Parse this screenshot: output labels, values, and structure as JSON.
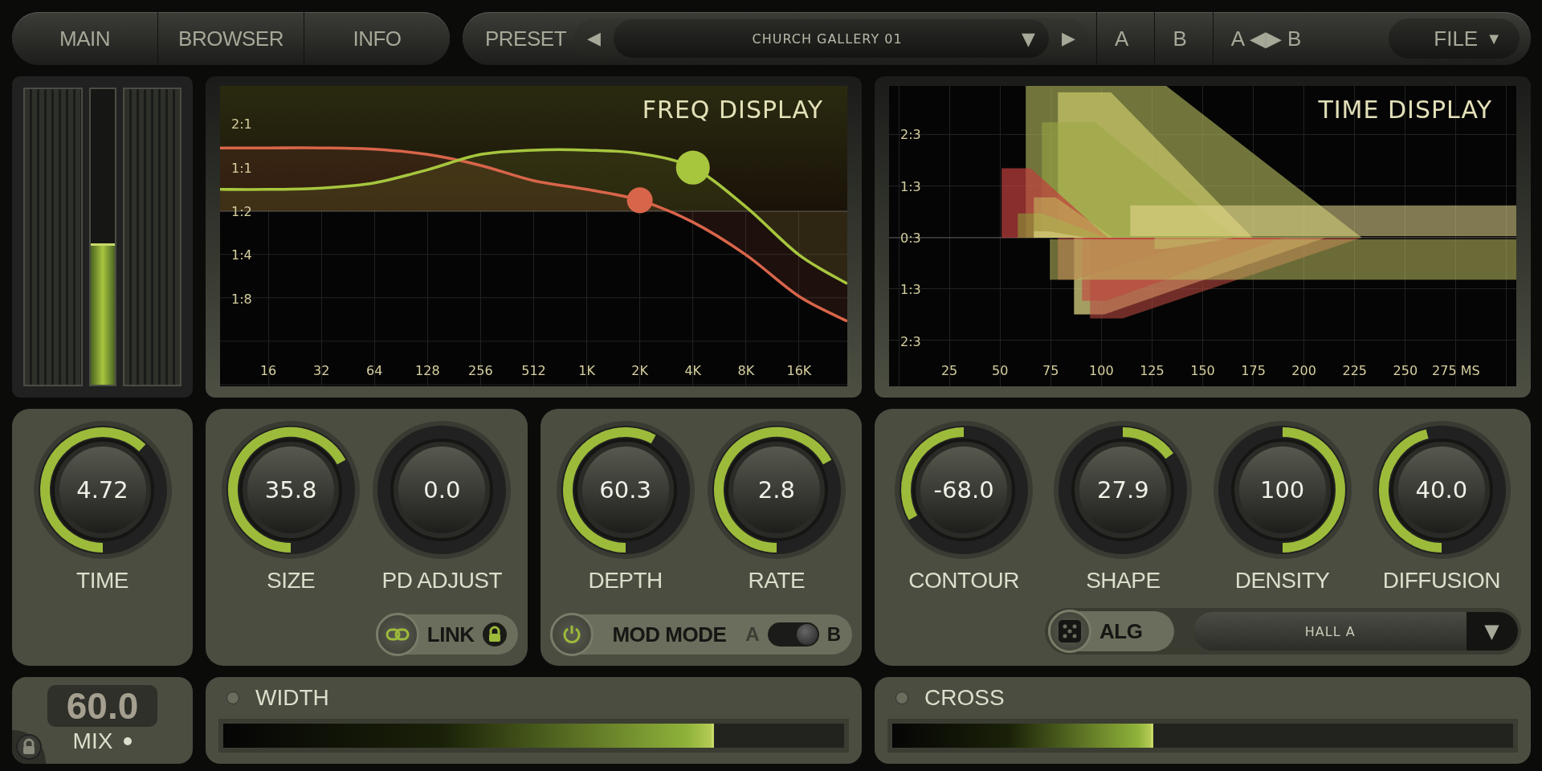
{
  "top_bar": {
    "tabs": [
      {
        "label": "MAIN",
        "selected": false
      },
      {
        "label": "BROWSER",
        "selected": false
      },
      {
        "label": "INFO",
        "selected": false
      }
    ],
    "preset": {
      "label": "PRESET",
      "prev": "◀",
      "name": "CHURCH GALLERY 01",
      "dropdown": "▼",
      "next": "▶"
    },
    "compare": [
      "A",
      "B",
      "A ◀▶ B"
    ],
    "file": {
      "label": "FILE",
      "caret": "▼"
    }
  },
  "meter": {
    "level": 0.47
  },
  "freq_display": {
    "title": "FREQ DISPLAY",
    "y_labels": [
      "2:1",
      "1:1",
      "1:2",
      "1:4",
      "1:8"
    ],
    "x_labels": [
      "16",
      "32",
      "64",
      "128",
      "256",
      "512",
      "1K",
      "2K",
      "4K",
      "8K",
      "16K"
    ]
  },
  "time_display": {
    "title": "TIME DISPLAY",
    "y_labels": [
      "2:3",
      "1:3",
      "0:3",
      "1:3",
      "2:3"
    ],
    "x_labels": [
      "25",
      "50",
      "75",
      "100",
      "125",
      "150",
      "175",
      "200",
      "225",
      "250",
      "275 MS"
    ]
  },
  "knob_groups": [
    {
      "knobs": [
        {
          "label": "TIME",
          "value": "4.72",
          "kind": "unipolar"
        }
      ]
    },
    {
      "knobs": [
        {
          "label": "SIZE",
          "value": "35.8",
          "kind": "unipolar"
        },
        {
          "label": "PD ADJUST",
          "value": "0.0",
          "kind": "unipolar"
        }
      ],
      "link": {
        "label": "LINK"
      }
    },
    {
      "knobs": [
        {
          "label": "DEPTH",
          "value": "60.3",
          "kind": "unipolar"
        },
        {
          "label": "RATE",
          "value": "2.8",
          "kind": "unipolar"
        }
      ],
      "mod_mode": {
        "label": "MOD MODE",
        "on": true,
        "options": [
          {
            "label": "A",
            "selected": false
          },
          {
            "label": "B",
            "selected": true
          }
        ]
      }
    },
    {
      "knobs": [
        {
          "label": "CONTOUR",
          "value": "-68.0",
          "kind": "bipolar"
        },
        {
          "label": "SHAPE",
          "value": "27.9",
          "kind": "bipolar"
        },
        {
          "label": "DENSITY",
          "value": "100",
          "kind": "bipolar"
        },
        {
          "label": "DIFFUSION",
          "value": "40.0",
          "kind": "unipolar"
        }
      ],
      "alg": {
        "label": "ALG",
        "value": "HALL A",
        "caret": "▼"
      }
    }
  ],
  "mix": {
    "value": "60.0",
    "label": "MIX"
  },
  "sliders": [
    {
      "label": "WIDTH",
      "on": false,
      "level": 0.79
    },
    {
      "label": "CROSS",
      "on": false,
      "level": 0.42
    }
  ]
}
